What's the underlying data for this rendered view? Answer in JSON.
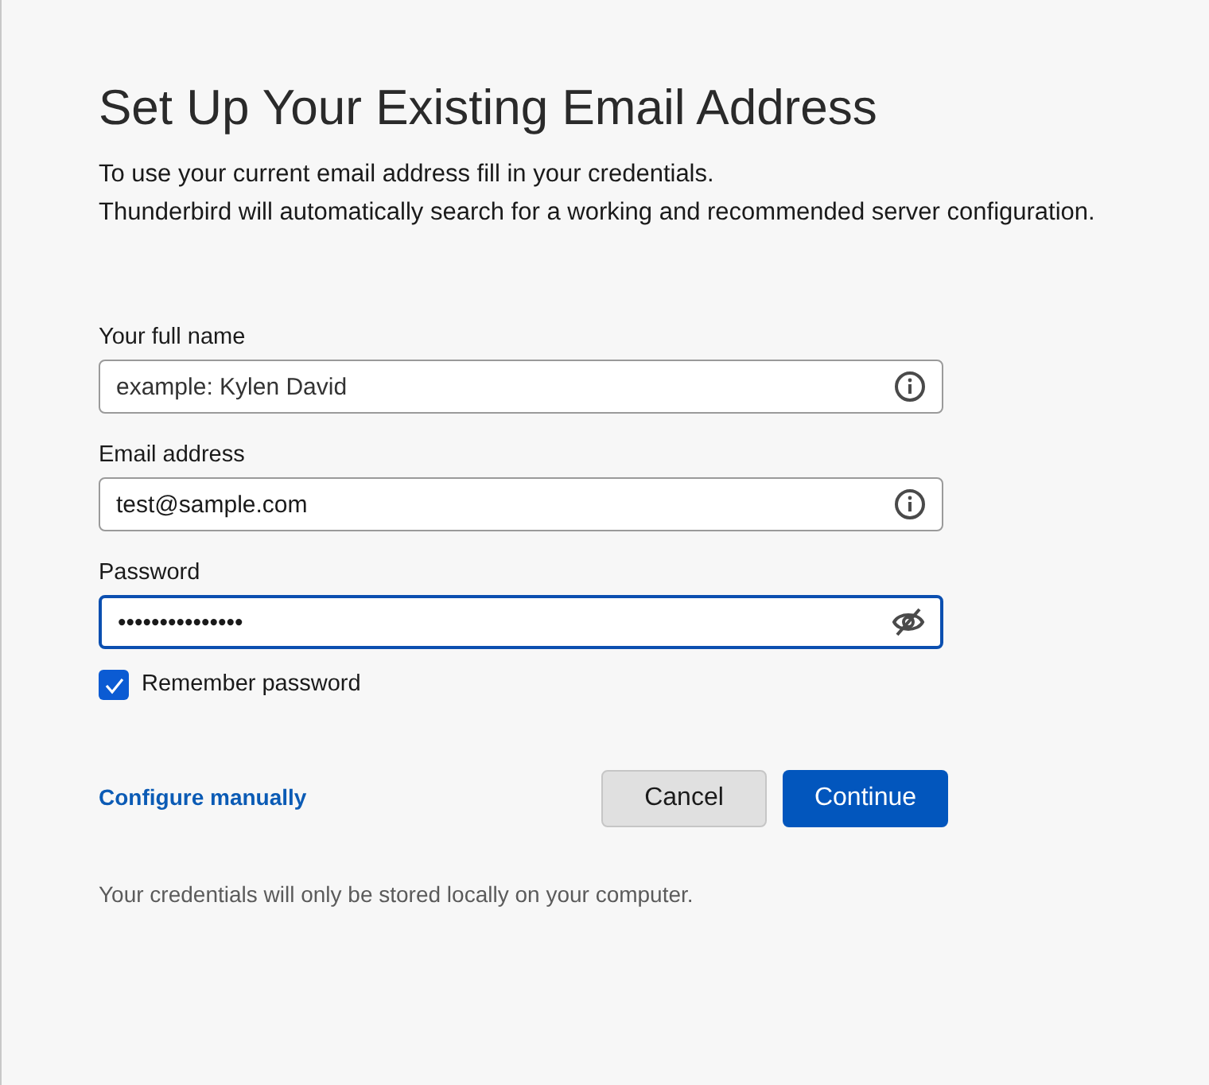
{
  "title": "Set Up Your Existing Email Address",
  "description": [
    "To use your current email address fill in your credentials.",
    "Thunderbird will automatically search for a working and recommended server configuration."
  ],
  "fields": [
    {
      "label": "Your full name",
      "placeholder": "example: Kylen David",
      "kind": "text",
      "focused": false
    },
    {
      "label": "Email address",
      "value": "test@sample.com",
      "kind": "text",
      "focused": false
    },
    {
      "label": "Password",
      "value": "•••••••••••••••",
      "kind": "password",
      "focused": true
    }
  ],
  "remember_password": {
    "label": "Remember password",
    "checked": true
  },
  "configure_link": "Configure manually",
  "buttons": [
    {
      "label": "Cancel",
      "kind": "secondary"
    },
    {
      "label": "Continue",
      "kind": "primary"
    }
  ],
  "footer": "Your credentials will only be stored locally on your computer."
}
